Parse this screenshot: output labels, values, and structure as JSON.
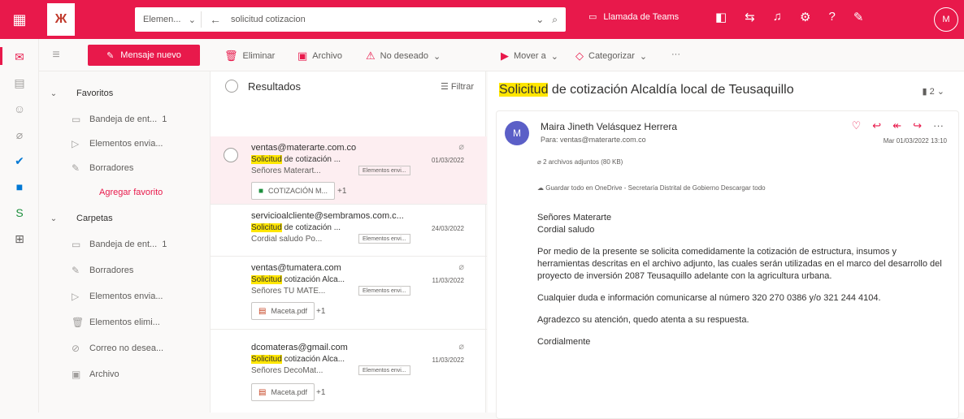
{
  "topbar": {
    "scope": "Elemen...",
    "query": "solicitud cotizacion",
    "teams_label": "Llamada de Teams",
    "avatar": "M"
  },
  "command_bar": {
    "new_message": "Mensaje nuevo",
    "delete": "Eliminar",
    "archive": "Archivo",
    "junk": "No deseado",
    "move_to": "Mover a",
    "categorize": "Categorizar",
    "more": "···"
  },
  "nav": {
    "favorites_label": "Favoritos",
    "favorites": [
      {
        "label": "Bandeja de ent...",
        "count": "1"
      },
      {
        "label": "Elementos envia...",
        "count": ""
      },
      {
        "label": "Borradores",
        "count": ""
      }
    ],
    "add_favorite": "Agregar favorito",
    "folders_label": "Carpetas",
    "folders": [
      {
        "label": "Bandeja de ent...",
        "count": "1"
      },
      {
        "label": "Borradores",
        "count": ""
      },
      {
        "label": "Elementos envia...",
        "count": ""
      },
      {
        "label": "Elementos elimi...",
        "count": ""
      },
      {
        "label": "Correo no desea...",
        "count": ""
      },
      {
        "label": "Archivo",
        "count": ""
      }
    ]
  },
  "list": {
    "title": "Resultados",
    "filter": "Filtrar",
    "messages": [
      {
        "from": "ventas@materarte.com.co",
        "hl": "Solicitud",
        "subject": " de cotización ...",
        "date": "01/03/2022",
        "preview": "Señores Materart...",
        "tag": "Elementos envi...",
        "attachment": "COTIZACIÓN M...",
        "more": "+1"
      },
      {
        "from": "servicioalcliente@sembramos.com.c...",
        "hl": "Solicitud",
        "subject": " de cotización ...",
        "date": "24/03/2022",
        "preview": "Cordial saludo Po...",
        "tag": "Elementos envi...",
        "attachment": "",
        "more": ""
      },
      {
        "from": "ventas@tumatera.com",
        "hl": "Solicitud",
        "subject": " cotización Alca...",
        "date": "11/03/2022",
        "preview": "Señores TU MATE...",
        "tag": "Elementos envi...",
        "attachment": "Maceta.pdf",
        "more": "+1"
      },
      {
        "from": "dcomateras@gmail.com",
        "hl": "Solicitud",
        "subject": " cotización Alca...",
        "date": "11/03/2022",
        "preview": "Señores DecoMat...",
        "tag": "Elementos envi...",
        "attachment": "Maceta.pdf",
        "more": "+1"
      }
    ]
  },
  "reading": {
    "subject_hl": "Solicitud",
    "subject_rest": " de cotización Alcaldía local de Teusaquillo",
    "count": "2",
    "avatar": "M",
    "sender": "Maira Jineth Velásquez Herrera",
    "to": "Para: ventas@materarte.com.co",
    "date": "Mar 01/03/2022 13:10",
    "attachments": "2 archivos adjuntos (80 KB)",
    "save_line": "Guardar todo en OneDrive - Secretaría Distrital de Gobierno    Descargar todo",
    "body": [
      "Señores Materarte",
      "Cordial saludo",
      "Por medio de la presente se solicita comedidamente la cotización de estructura, insumos y herramientas descritas en el archivo adjunto, las cuales serán utilizadas en el marco del desarrollo del proyecto de inversión 2087 Teusaquillo adelante con la agricultura urbana.",
      "Cualquier duda e información comunicarse al número 320 270 0386 y/o 321 244 4104.",
      "Agradezco su atención, quedo atenta a su respuesta.",
      "Cordialmente"
    ]
  },
  "colors": {
    "accent": "#e8194b",
    "highlight": "#ffe600",
    "selected": "#fdeef1"
  }
}
